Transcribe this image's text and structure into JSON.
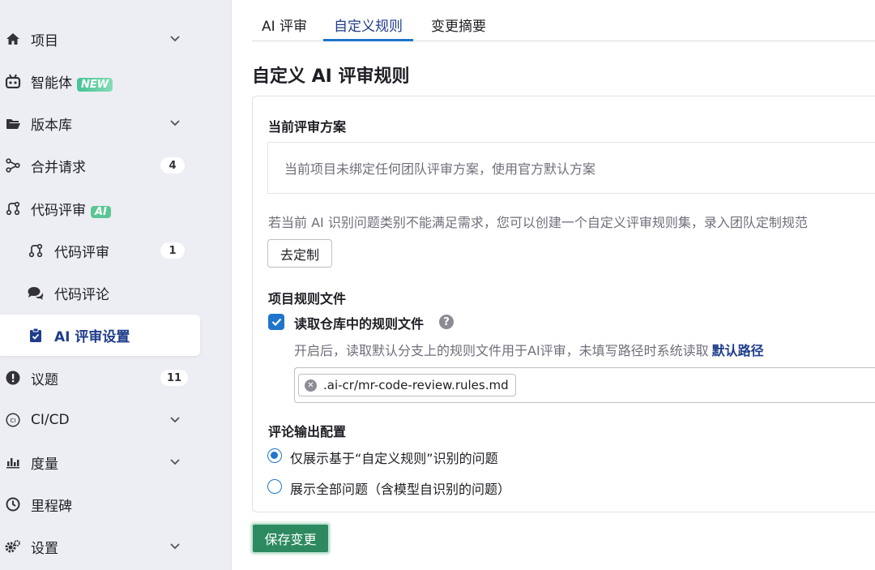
{
  "sidebar": {
    "items": [
      {
        "label": "项目",
        "icon": "home-icon",
        "chevron": true
      },
      {
        "label": "智能体",
        "icon": "robot-icon",
        "badge": "NEW"
      },
      {
        "label": "版本库",
        "icon": "folder-icon",
        "chevron": true
      },
      {
        "label": "合并请求",
        "icon": "merge-request-icon",
        "count": "4"
      },
      {
        "label": "代码评审",
        "icon": "code-review-icon",
        "badge": "AI"
      },
      {
        "label": "代码评审",
        "icon": "code-review-icon",
        "count": "1"
      },
      {
        "label": "代码评论",
        "icon": "comments-icon"
      },
      {
        "label": "AI 评审设置",
        "icon": "clipboard-check-icon"
      },
      {
        "label": "议题",
        "icon": "issues-icon",
        "count": "11"
      },
      {
        "label": "CI/CD",
        "icon": "ci-icon",
        "chevron": true
      },
      {
        "label": "度量",
        "icon": "chart-icon",
        "chevron": true
      },
      {
        "label": "里程碑",
        "icon": "clock-icon"
      },
      {
        "label": "设置",
        "icon": "settings-icon",
        "chevron": true
      }
    ]
  },
  "tabs": [
    {
      "label": "AI 评审"
    },
    {
      "label": "自定义规则"
    },
    {
      "label": "变更摘要"
    }
  ],
  "page": {
    "title": "自定义 AI 评审规则",
    "current_scheme": {
      "title": "当前评审方案",
      "empty_text": "当前项目未绑定任何团队评审方案，使用官方默认方案",
      "helper": "若当前 AI 识别问题类别不能满足需求，您可以创建一个自定义评审规则集，录入团队定制规范",
      "customize_button": "去定制"
    },
    "rule_files": {
      "title": "项目规则文件",
      "checkbox_label": "读取仓库中的规则文件",
      "help": "?",
      "description": "开启后，读取默认分支上的规则文件用于AI评审，未填写路径时系统读取",
      "link": "默认路径",
      "token": ".ai-cr/mr-code-review.rules.md"
    },
    "output": {
      "title": "评论输出配置",
      "option_1": "仅展示基于“自定义规则”识别的问题",
      "option_2": "展示全部问题（含模型自识别的问题）"
    },
    "save_button": "保存变更"
  },
  "colors": {
    "accent": "#1f75cb",
    "save": "#2d8a60",
    "sidebar_bg": "#eceef4"
  }
}
